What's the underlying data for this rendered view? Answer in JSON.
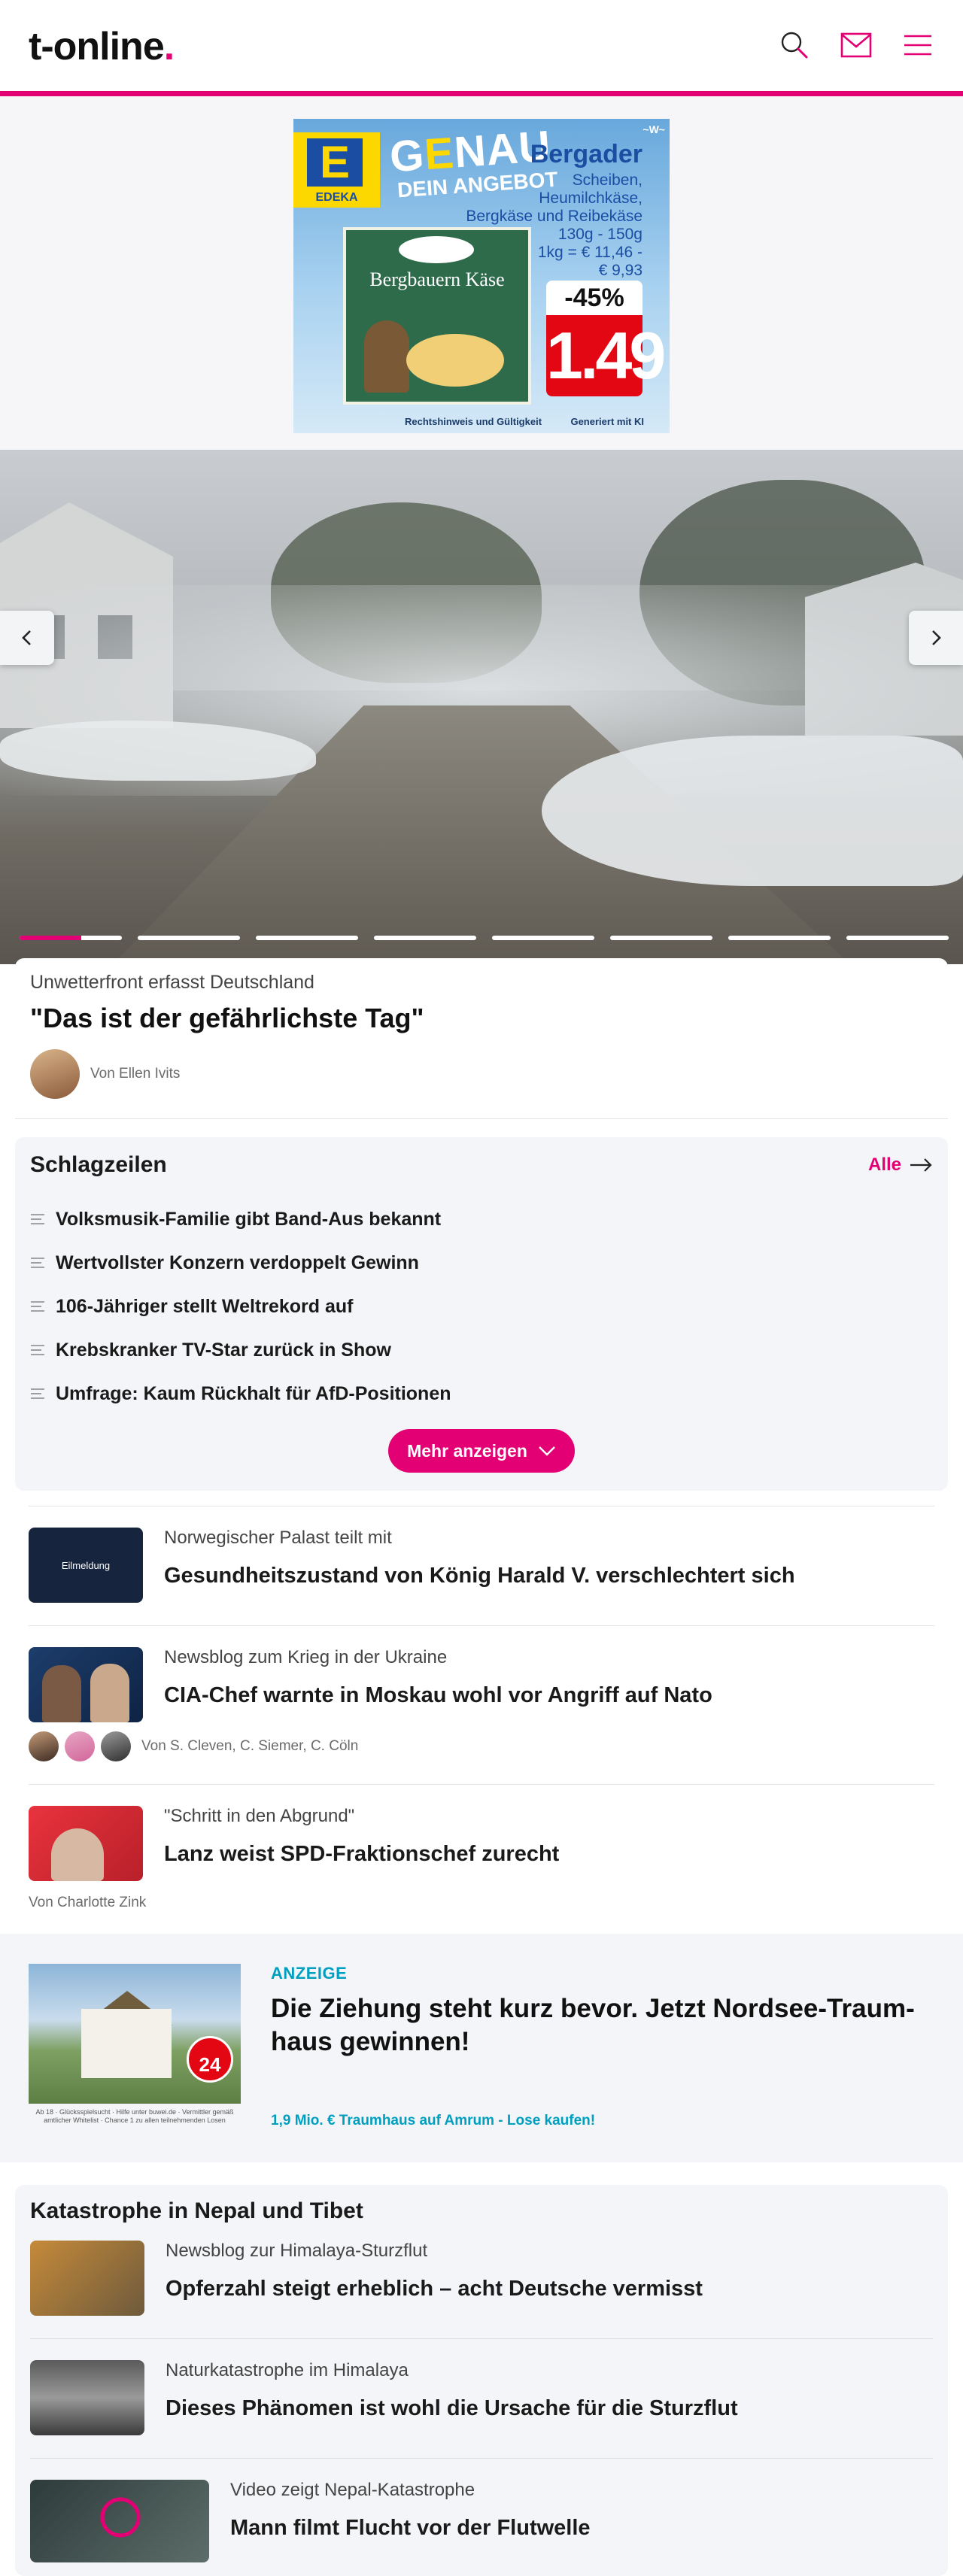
{
  "header": {
    "logo_text": "t-online",
    "logo_dot": ".",
    "icons": [
      "search-icon",
      "mail-icon",
      "menu-icon"
    ],
    "accent": "#e20074"
  },
  "ad": {
    "edeka": "EDEKA",
    "genau_pre": "G",
    "genau_hi": "E",
    "genau_post": "NAU",
    "dein": "DEIN ANGEBOT",
    "brand": "Bergader",
    "w_mark": "~W~",
    "desc_lines": [
      "Scheiben,",
      "Heumilchkäse,",
      "Bergkäse und Reibekäse",
      "130g - 150g",
      "1kg = € 11,46 -",
      "€ 9,93"
    ],
    "pack_logo": "Bergader",
    "pack_name": "Bergbauern Käse",
    "discount": "-45%",
    "price": "1.49",
    "footer_left": "Rechtshinweis und Gültigkeit",
    "footer_right": "Generiert mit KI"
  },
  "hero": {
    "kicker": "Unwetterfront erfasst Deutschland",
    "headline": "\"Das ist der gefährlichste Tag\"",
    "author": "Von Ellen Ivits",
    "slides": 8,
    "active_slide_progress": 0.6
  },
  "headlines": {
    "title": "Schlagzeilen",
    "all_label": "Alle",
    "items": [
      "Volksmusik-Familie gibt Band-Aus bekannt",
      "Wertvollster Konzern verdoppelt Gewinn",
      "106-Jähriger stellt Weltrekord auf",
      "Krebskranker TV-Star zurück in Show",
      "Umfrage: Kaum Rückhalt für AfD-Positionen"
    ],
    "more_label": "Mehr anzeigen"
  },
  "teasers": [
    {
      "thumb_label": "Eilmeldung",
      "kicker": "Norwegischer Palast teilt mit",
      "title": "Gesundheitszustand von König Harald V. verschlechtert sich"
    },
    {
      "kicker": "Newsblog zum Krieg in der Ukraine",
      "title": "CIA-Chef warnte in Moskau wohl vor Angriff auf Nato",
      "byline": "Von S. Cleven, C. Siemer, C. Cöln"
    },
    {
      "kicker": "\"Schritt in den Abgrund\"",
      "title": "Lanz weist SPD-Fraktionschef zurecht",
      "byline": "Von Charlotte Zink"
    }
  ],
  "anzeige": {
    "label": "ANZEIGE",
    "title": "Die Ziehung steht kurz bevor. Jetzt Nordsee-Traum-haus gewinnen!",
    "link": "1,9 Mio. € Traumhaus auf Amrum - Lose kaufen!",
    "badge": "24",
    "small_print": "Ab 18 · Glücksspielsucht · Hilfe unter buwei.de · Vermittler gemäß amtlicher Whitelist · Chance 1 zu allen teilnehmenden Losen"
  },
  "nepal": {
    "title": "Katastrophe in Nepal und Tibet",
    "items": [
      {
        "kicker": "Newsblog zur Himalaya-Sturzflut",
        "title": "Opferzahl steigt erheblich – acht Deutsche vermisst"
      },
      {
        "kicker": "Naturkatastrophe im Himalaya",
        "title": "Dieses Phänomen ist wohl die Ursache für die Sturzflut"
      },
      {
        "kicker": "Video zeigt Nepal-Katastrophe",
        "title": "Mann filmt Flucht vor der Flutwelle"
      }
    ]
  }
}
